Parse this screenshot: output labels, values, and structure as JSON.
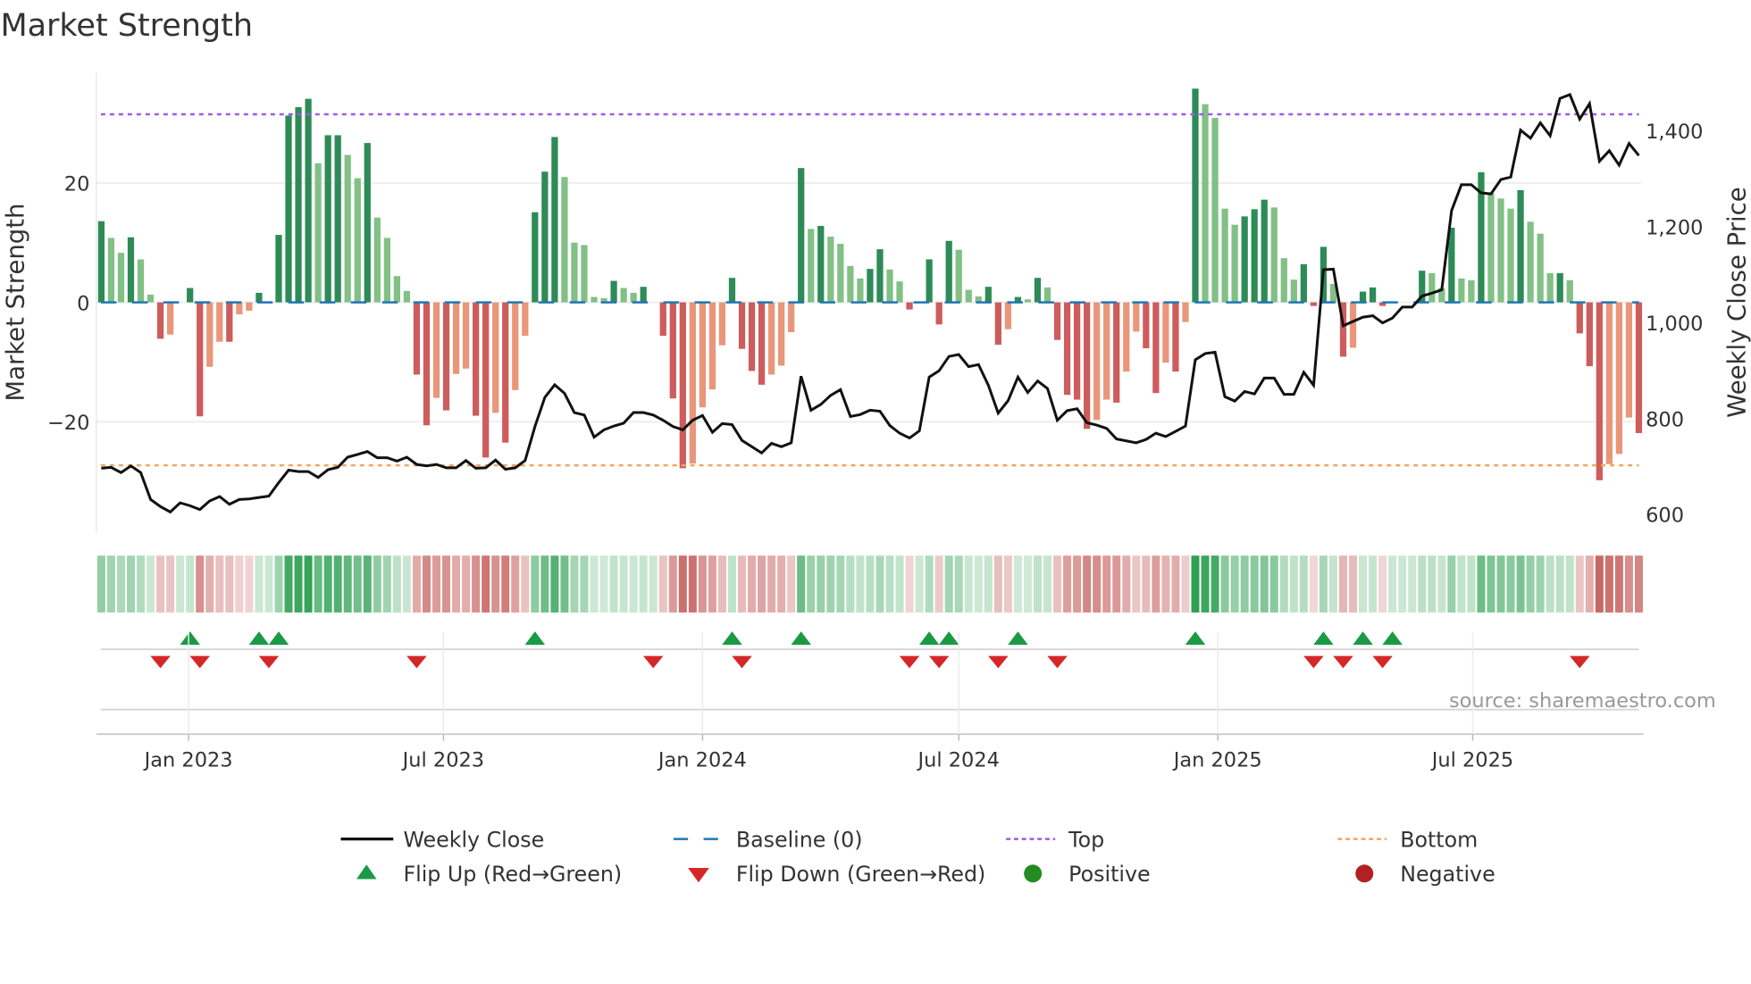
{
  "chart_data": {
    "type": "bar",
    "title": "Market Strength",
    "ylabel": "Market Strength",
    "ylabel_right": "Weekly Close Price",
    "source": "source: sharemaestro.com",
    "start_date": "2022-10-31",
    "frequency": "weekly",
    "ylim": [
      -36,
      38
    ],
    "ylim_right": [
      540,
      1550
    ],
    "top_level": 31.5,
    "bottom_level": -27.3,
    "baseline": 0,
    "y_ticks": [
      {
        "value": 20,
        "label": "20"
      },
      {
        "value": 0,
        "label": "0"
      },
      {
        "value": -20,
        "label": "−20"
      }
    ],
    "y_ticks_right": [
      {
        "value": 1400,
        "label": "1,400"
      },
      {
        "value": 1200,
        "label": "1,200"
      },
      {
        "value": 1000,
        "label": "1,000"
      },
      {
        "value": 800,
        "label": "800"
      },
      {
        "value": 600,
        "label": "600"
      }
    ],
    "x_ticks": [
      {
        "date": "2023-01-01",
        "label": "Jan 2023"
      },
      {
        "date": "2023-07-01",
        "label": "Jul 2023"
      },
      {
        "date": "2024-01-01",
        "label": "Jan 2024"
      },
      {
        "date": "2024-07-01",
        "label": "Jul 2024"
      },
      {
        "date": "2025-01-01",
        "label": "Jan 2025"
      },
      {
        "date": "2025-07-01",
        "label": "Jul 2025"
      }
    ],
    "strength": [
      13.6,
      10.8,
      8.3,
      10.9,
      7.2,
      1.3,
      -6.1,
      -5.4,
      0,
      2.4,
      -19.1,
      -10.8,
      -6.6,
      -6.6,
      -2.0,
      -1.4,
      1.6,
      0,
      11.3,
      31.3,
      32.7,
      34.1,
      23.3,
      28,
      28,
      24.7,
      20.8,
      26.7,
      14.2,
      10.8,
      4.4,
      1.9,
      -12.1,
      -20.6,
      -16.0,
      -18.1,
      -12.0,
      -11.1,
      -19.0,
      -26.0,
      -18.5,
      -23.5,
      -14.7,
      -5.6,
      15.1,
      21.9,
      27.7,
      21,
      10,
      9.6,
      0.9,
      0.7,
      3.6,
      2.4,
      1.6,
      2.6,
      0,
      -5.6,
      -16.1,
      -27.8,
      -27,
      -17.6,
      -14.6,
      -7.2,
      4.1,
      -7.8,
      -11.5,
      -13.8,
      -12.1,
      -10.6,
      -5.0,
      22.5,
      12.3,
      12.8,
      11.0,
      9.8,
      6.1,
      4.0,
      5.6,
      8.9,
      5.5,
      3.5,
      -1.2,
      0,
      7.2,
      -3.7,
      10.3,
      8.8,
      2.1,
      1.0,
      2.6,
      -7.1,
      -4.5,
      0.9,
      0.5,
      4.1,
      2.5,
      -6.3,
      -15.5,
      -16.3,
      -21.2,
      -19.7,
      -16.3,
      -16.8,
      -11.6,
      -4.9,
      -7.7,
      -15.2,
      -10.1,
      -11.6,
      -3.3,
      35.8,
      33.2,
      30.9,
      15.7,
      13.0,
      14.4,
      15.6,
      17.2,
      15.9,
      7.4,
      3.8,
      6.4,
      -0.6,
      9.3,
      3.1,
      -9.1,
      -7.6,
      1.8,
      2.5,
      -0.6,
      0,
      0,
      0,
      5.3,
      4.9,
      2.4,
      12.5,
      4.0,
      3.7,
      21.8,
      18.3,
      17.4,
      15.7,
      18.8,
      13.5,
      11.5,
      4.9,
      4.9,
      3.7,
      -5.2,
      -10.7,
      -29.8,
      -27.1,
      -25.4,
      -19.3,
      -21.9
    ],
    "weekly_close": [
      696,
      698,
      687,
      701,
      687,
      631,
      616,
      605,
      624,
      618,
      610,
      628,
      637,
      621,
      631,
      632,
      635,
      638,
      666,
      692,
      689,
      689,
      677,
      693,
      698,
      719,
      725,
      731,
      718,
      718,
      711,
      719,
      704,
      701,
      704,
      697,
      697,
      712,
      696,
      697,
      713,
      694,
      697,
      712,
      783,
      844,
      870,
      852,
      812,
      807,
      761,
      776,
      784,
      790,
      812,
      812,
      807,
      796,
      783,
      776,
      796,
      806,
      771,
      789,
      787,
      754,
      741,
      728,
      748,
      741,
      749,
      888,
      817,
      829,
      848,
      860,
      804,
      808,
      817,
      815,
      785,
      769,
      759,
      774,
      886,
      899,
      929,
      933,
      908,
      912,
      869,
      811,
      837,
      886,
      854,
      878,
      862,
      796,
      816,
      820,
      791,
      786,
      779,
      757,
      753,
      749,
      756,
      769,
      762,
      773,
      784,
      922,
      935,
      938,
      845,
      836,
      856,
      851,
      884,
      884,
      850,
      850,
      896,
      869,
      1110,
      1111,
      993,
      1002,
      1011,
      1014,
      999,
      1009,
      1032,
      1032,
      1055,
      1061,
      1068,
      1233,
      1287,
      1287,
      1270,
      1268,
      1298,
      1303,
      1401,
      1384,
      1416,
      1389,
      1467,
      1475,
      1424,
      1456,
      1336,
      1358,
      1328,
      1373,
      1348
    ],
    "flip_up_weeks": [
      9,
      16,
      18,
      44,
      64,
      71,
      84,
      86,
      93,
      111,
      124,
      128,
      131
    ],
    "flip_down_weeks": [
      6,
      10,
      17,
      32,
      56,
      65,
      82,
      85,
      91,
      97,
      123,
      126,
      130,
      150
    ],
    "legend": {
      "placement": "bottom",
      "items": [
        {
          "label": "Weekly Close",
          "kind": "line",
          "color": "#111111"
        },
        {
          "label": "Baseline (0)",
          "kind": "dash",
          "color": "#1f77b4"
        },
        {
          "label": "Top",
          "kind": "dot",
          "color": "#9b5de5"
        },
        {
          "label": "Bottom",
          "kind": "dot",
          "color": "#f4a460"
        },
        {
          "label": "Flip Up (Red→Green)",
          "kind": "tri-up",
          "color": "#1a9a45"
        },
        {
          "label": "Flip Down (Green→Red)",
          "kind": "tri-down",
          "color": "#d62728"
        },
        {
          "label": "Positive",
          "kind": "circle",
          "color": "#228b22"
        },
        {
          "label": "Negative",
          "kind": "circle",
          "color": "#b22222"
        }
      ]
    },
    "colors": {
      "pos_dark": "#2e8b57",
      "pos_light": "#82c086",
      "neg_dark": "#cd5c5c",
      "neg_light": "#e9967a",
      "heat_pos": "#2ea052",
      "heat_neg": "#c0504d"
    }
  }
}
